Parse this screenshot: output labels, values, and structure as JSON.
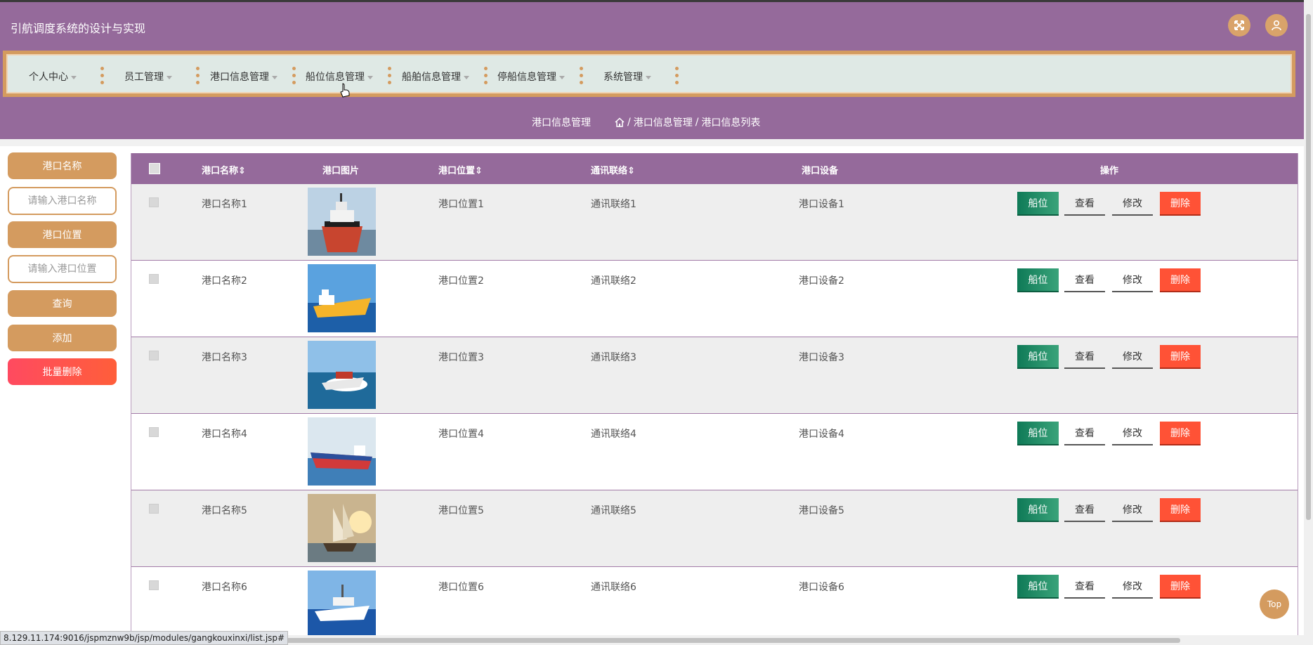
{
  "app": {
    "title": "引航调度系统的设计与实现"
  },
  "nav": {
    "items": [
      {
        "label": "个人中心"
      },
      {
        "label": "员工管理"
      },
      {
        "label": "港口信息管理"
      },
      {
        "label": "船位信息管理"
      },
      {
        "label": "船舶信息管理"
      },
      {
        "label": "停船信息管理"
      },
      {
        "label": "系统管理"
      }
    ]
  },
  "breadcrumb": {
    "page_title": "港口信息管理",
    "path": [
      "港口信息管理",
      "港口信息列表"
    ],
    "separator": "/"
  },
  "sidebar": {
    "name_label": "港口名称",
    "name_placeholder": "请输入港口名称",
    "location_label": "港口位置",
    "location_placeholder": "请输入港口位置",
    "query_label": "查询",
    "add_label": "添加",
    "batch_delete_label": "批量删除"
  },
  "table": {
    "columns": [
      "港口名称",
      "港口图片",
      "港口位置",
      "通讯联络",
      "港口设备",
      "操作"
    ],
    "sort_glyph": "⇕",
    "actions": {
      "berth": "船位",
      "view": "查看",
      "edit": "修改",
      "delete": "删除"
    },
    "rows": [
      {
        "name": "港口名称1",
        "location": "港口位置1",
        "contact": "通讯联络1",
        "equipment": "港口设备1",
        "image": "ship-red-hull"
      },
      {
        "name": "港口名称2",
        "location": "港口位置2",
        "contact": "通讯联络2",
        "equipment": "港口设备2",
        "image": "ship-yellow"
      },
      {
        "name": "港口名称3",
        "location": "港口位置3",
        "contact": "通讯联络3",
        "equipment": "港口设备3",
        "image": "speedboat"
      },
      {
        "name": "港口名称4",
        "location": "港口位置4",
        "contact": "通讯联络4",
        "equipment": "港口设备4",
        "image": "cargo-ship-blue-red"
      },
      {
        "name": "港口名称5",
        "location": "港口位置5",
        "contact": "通讯联络5",
        "equipment": "港口设备5",
        "image": "sailing-ship"
      },
      {
        "name": "港口名称6",
        "location": "港口位置6",
        "contact": "通讯联络6",
        "equipment": "港口设备6",
        "image": "yacht"
      }
    ]
  },
  "status_url": "8.129.11.174:9016/jspmznw9b/jsp/modules/gangkouxinxi/list.jsp#",
  "back_to_top": "Top",
  "colors": {
    "primary": "#956a9b",
    "accent": "#d49b5f",
    "berth": "#0f7a57",
    "delete": "#ff5236"
  },
  "icons": [
    "fullscreen-icon",
    "user-icon",
    "home-icon",
    "cursor-icon"
  ]
}
